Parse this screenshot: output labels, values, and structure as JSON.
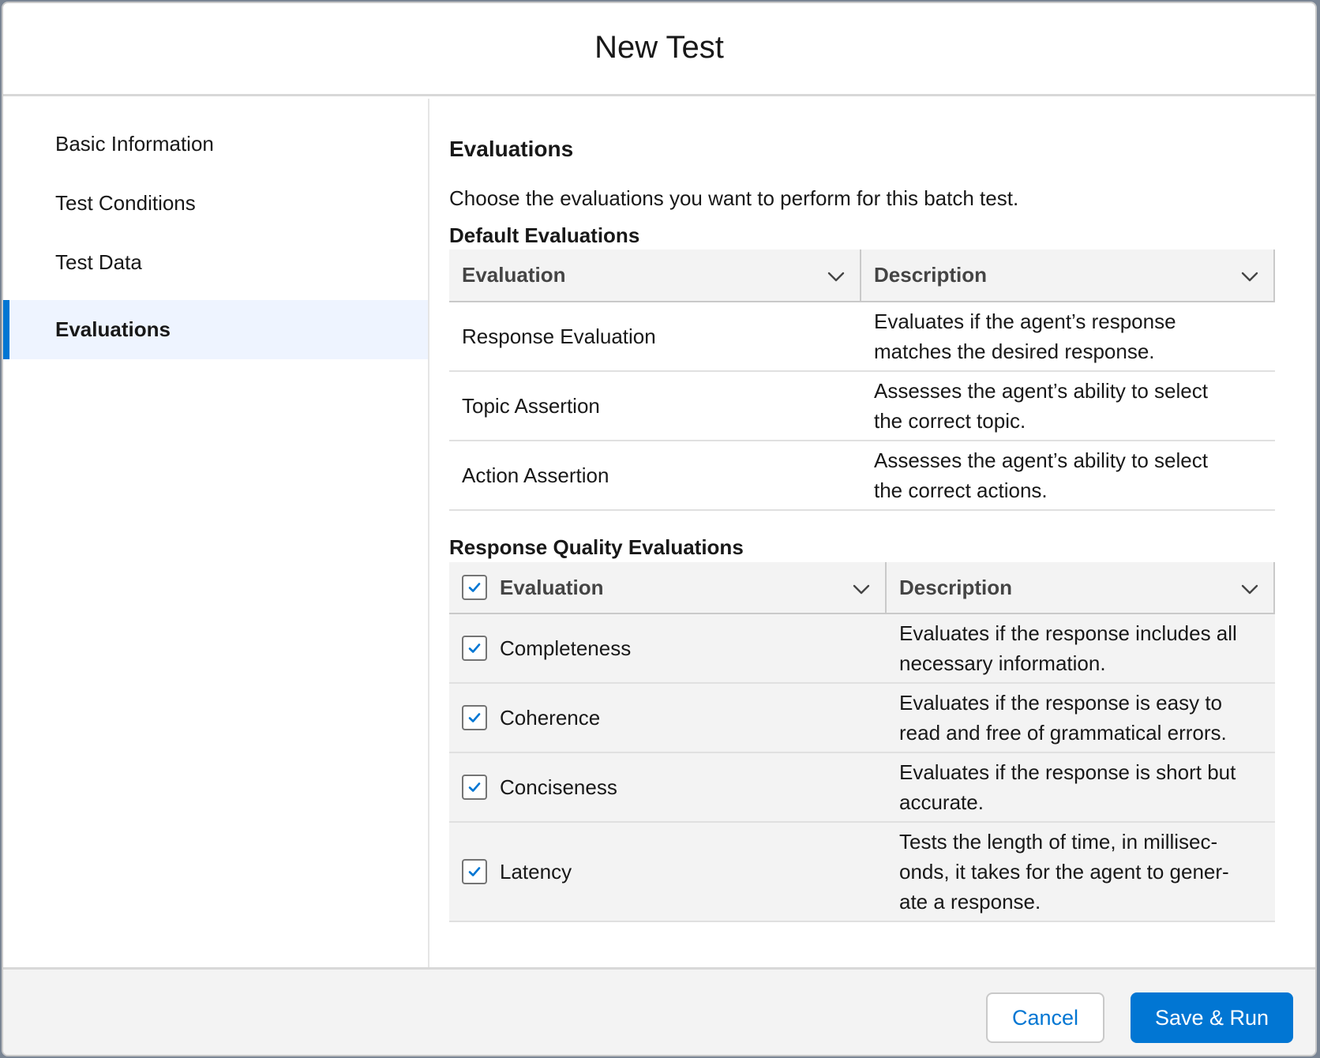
{
  "modal": {
    "title": "New Test"
  },
  "sidebar": {
    "items": [
      {
        "label": "Basic Information"
      },
      {
        "label": "Test Conditions"
      },
      {
        "label": "Test Data"
      },
      {
        "label": "Evaluations",
        "active": true
      }
    ]
  },
  "content": {
    "title": "Evaluations",
    "description": "Choose the evaluations you want to perform for this batch test.",
    "default_section": {
      "title": "Default Evaluations",
      "columns": [
        "Evaluation",
        "Description"
      ],
      "rows": [
        {
          "evaluation": "Response Evaluation",
          "description_1": "Evaluates if the agent’s response",
          "description_2": "matches the desired response."
        },
        {
          "evaluation": "Topic Assertion",
          "description_1": "Assesses the agent’s ability to select",
          "description_2": "the correct topic."
        },
        {
          "evaluation": "Action Assertion",
          "description_1": "Assesses the agent’s ability to select",
          "description_2": "the correct actions."
        }
      ]
    },
    "quality_section": {
      "title": "Response Quality Evaluations",
      "columns": [
        "Evaluation",
        "Description"
      ],
      "select_all_checked": true,
      "rows": [
        {
          "evaluation": "Completeness",
          "checked": true,
          "description_1": "Evaluates if the response includes all",
          "description_2": "necessary information.",
          "description_3": ""
        },
        {
          "evaluation": "Coherence",
          "checked": true,
          "description_1": "Evaluates if the response is easy to",
          "description_2": "read and free of grammatical errors.",
          "description_3": ""
        },
        {
          "evaluation": "Conciseness",
          "checked": true,
          "description_1": "Evaluates if the response is short but",
          "description_2": "accurate.",
          "description_3": ""
        },
        {
          "evaluation": "Latency",
          "checked": true,
          "description_1": "Tests the length of time, in millisec-",
          "description_2": "onds, it takes for the agent to gener-",
          "description_3": "ate a response."
        }
      ]
    }
  },
  "footer": {
    "cancel_label": "Cancel",
    "primary_label": "Save & Run"
  },
  "colors": {
    "brand": "#0176d3",
    "nav_active_bg": "#eef4ff",
    "header_bg": "#f3f3f3"
  }
}
